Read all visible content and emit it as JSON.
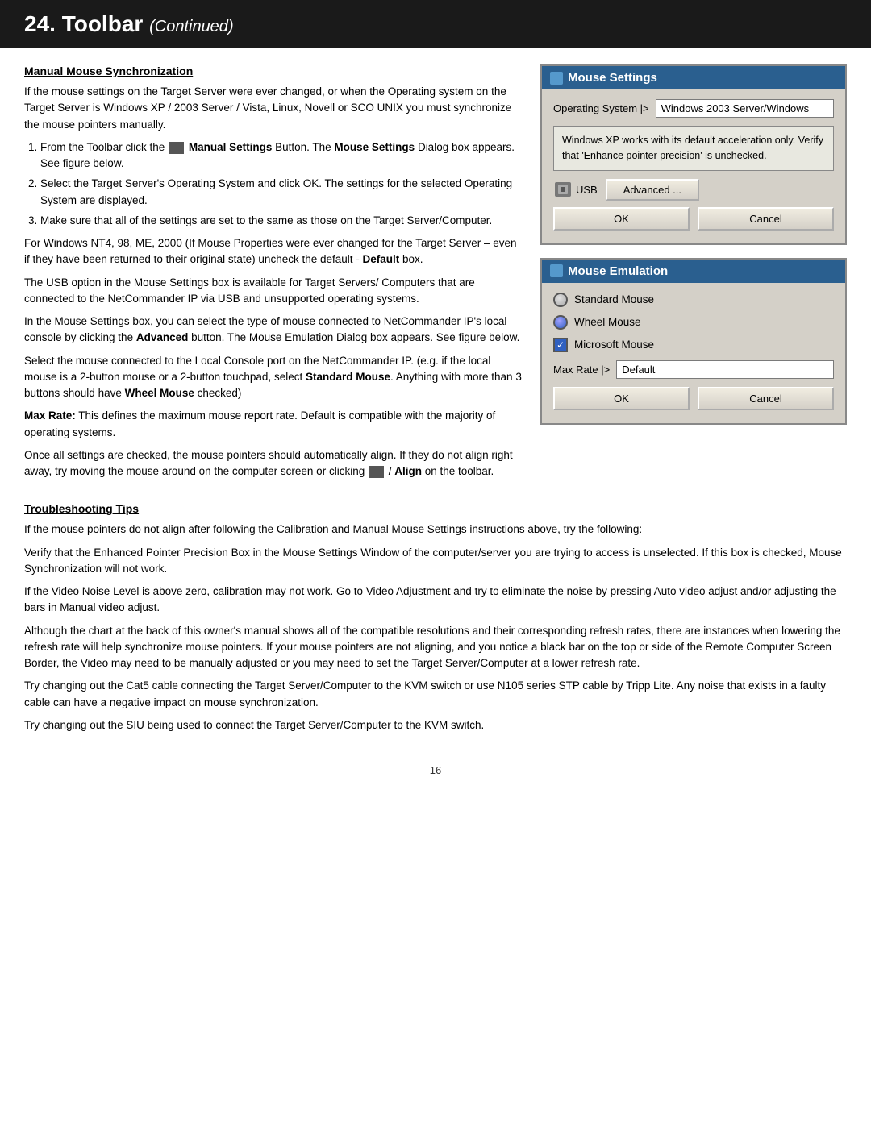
{
  "header": {
    "title": "24. Toolbar",
    "continued": "Continued"
  },
  "left": {
    "section1_title": "Manual Mouse Synchronization",
    "para1": "If the mouse settings on the Target Server were ever changed, or when the Operating system on the Target Server is Windows XP / 2003 Server / Vista, Linux, Novell or SCO UNIX you must synchronize the mouse pointers manually.",
    "steps": [
      "From the Toolbar click the  Manual Settings Button. The Mouse Settings Dialog box appears. See figure below.",
      "Select the Target Server's Operating System and click OK. The settings for the selected Operating System are displayed.",
      "Make sure that all of the settings are set to the same as those on the Target Server/Computer."
    ],
    "para2": "For Windows NT4, 98, ME, 2000 (If Mouse Properties were ever changed for the Target Server – even if they have been returned to their original state) uncheck the default - Default box.",
    "para3": "The USB option in the Mouse Settings box is available for Target Servers/ Computers that are connected to the NetCommander IP via USB and unsupported operating systems.",
    "para4": "In the Mouse Settings box, you can select the type of mouse connected to NetCommander IP's local console by clicking the Advanced button. The Mouse Emulation Dialog box appears. See figure below.",
    "para5": "Select the mouse connected to the Local Console port on the NetCommander IP. (e.g. if the local mouse is a 2-button mouse or a 2-button touchpad, select Standard Mouse. Anything with more than 3 buttons should have Wheel Mouse checked)",
    "para6_bold": "Max Rate:",
    "para6_rest": " This defines the maximum mouse report rate. Default is compatible with the majority of operating systems.",
    "para7": "Once all settings are checked, the mouse pointers should automatically align. If they do not align right away, try moving the mouse around on the computer screen or clicking",
    "para7_align": "/ Align on the toolbar.",
    "section2_title": "Troubleshooting Tips",
    "trouble_paras": [
      "If the mouse pointers do not align after following the Calibration and Manual Mouse Settings instructions above, try the following:",
      "Verify that the Enhanced Pointer Precision Box in the Mouse Settings Window of the computer/server you are trying to access is unselected. If this box is checked, Mouse Synchronization will not work.",
      "If the Video Noise Level is above zero, calibration may not work. Go to Video Adjustment and try to eliminate the noise by pressing Auto video adjust and/or adjusting the bars in Manual video adjust.",
      "Although the chart at the back of this owner's manual shows all of the compatible resolutions and their corresponding refresh rates, there are instances when lowering the refresh rate will help synchronize mouse pointers. If your mouse pointers are not aligning, and you notice a black bar on the top or side of the Remote Computer Screen Border, the Video may need to be manually adjusted or you may need to set the Target Server/Computer at a lower refresh rate.",
      "Try changing out the Cat5 cable connecting the Target Server/Computer to the KVM switch or use N105 series STP cable by Tripp Lite. Any noise that exists in a faulty cable can have a negative impact on mouse synchronization.",
      "Try changing out the SIU being used to connect the Target Server/Computer to the KVM switch."
    ]
  },
  "mouse_settings_dialog": {
    "title": "Mouse Settings",
    "os_label": "Operating System |>",
    "os_value": "Windows 2003 Server/Windows",
    "info_text": "Windows XP works with its default acceleration only. Verify that 'Enhance pointer precision' is unchecked.",
    "usb_label": "USB",
    "advanced_label": "Advanced ...",
    "ok_label": "OK",
    "cancel_label": "Cancel"
  },
  "mouse_emulation_dialog": {
    "title": "Mouse Emulation",
    "standard_mouse_label": "Standard Mouse",
    "wheel_mouse_label": "Wheel Mouse",
    "microsoft_mouse_label": "Microsoft Mouse",
    "max_rate_label": "Max Rate |>",
    "max_rate_value": "Default",
    "ok_label": "OK",
    "cancel_label": "Cancel"
  },
  "page_number": "16"
}
